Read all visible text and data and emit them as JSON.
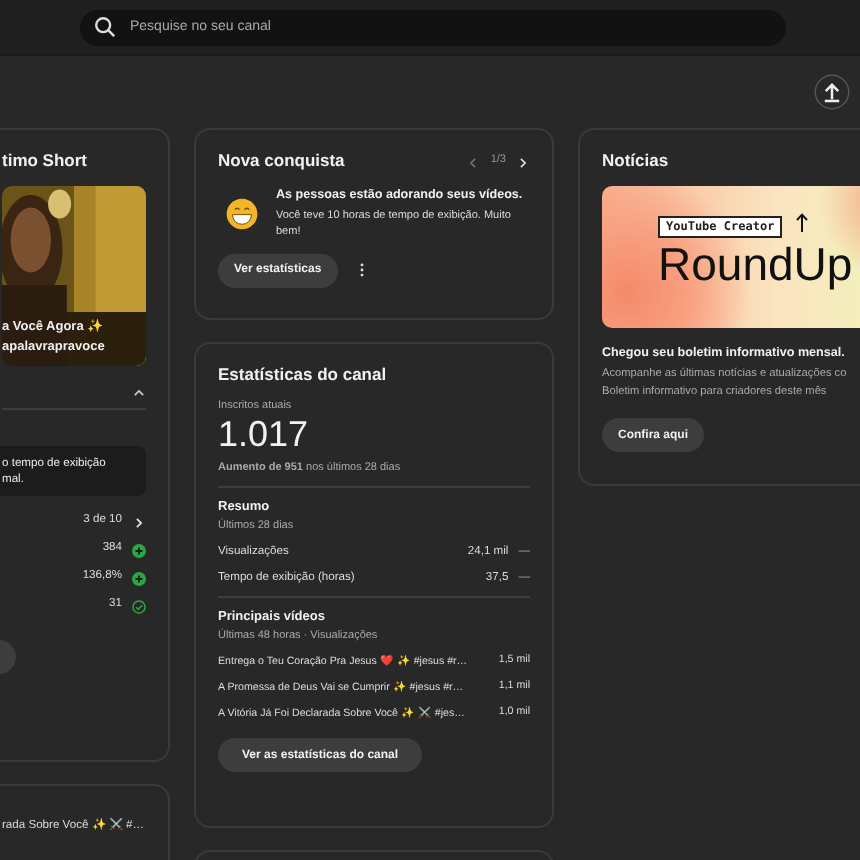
{
  "search": {
    "placeholder": "Pesquise no seu canal"
  },
  "short_card": {
    "title": "timo Short",
    "overlay_lines": [
      "a Você Agora ✨",
      "apalavrapravoce"
    ],
    "tip_lines": [
      "o tempo de exibição",
      "mal."
    ],
    "metrics": [
      {
        "kind": "pager",
        "value": "3 de 10"
      },
      {
        "kind": "up",
        "value": "384"
      },
      {
        "kind": "up",
        "value": "136,8%"
      },
      {
        "kind": "check",
        "value": "31"
      }
    ]
  },
  "short_card_2": {
    "line": "rada Sobre Você ✨ ⚔️ #…"
  },
  "achievement": {
    "title": "Nova conquista",
    "pager": {
      "text": "1/3",
      "prev_enabled": false,
      "next_enabled": true
    },
    "headline": "As pessoas estão adorando seus vídeos.",
    "body": "Você teve 10 horas de tempo de exibição. Muito bem!",
    "button": "Ver estatísticas"
  },
  "channel_stats": {
    "title": "Estatísticas do canal",
    "subscribers_label": "Inscritos atuais",
    "subscribers": "1.017",
    "growth": "**Aumento de 951** nos últimos 28 dias",
    "summary_title": "Resumo",
    "summary_period": "Últimos 28 dias",
    "summary": [
      {
        "label": "Visualizações",
        "value": "24,1 mil",
        "trend": "—"
      },
      {
        "label": "Tempo de exibição (horas)",
        "value": "37,5",
        "trend": "—"
      }
    ],
    "top_title": "Principais vídeos",
    "top_period": "Últimas 48 horas · Visualizações",
    "top_videos": [
      {
        "title": "Entrega o Teu Coração Pra Jesus ❤️ ✨ #jesus #r…",
        "views": "1,5 mil"
      },
      {
        "title": "A Promessa de Deus Vai se Cumprir ✨ #jesus #r…",
        "views": "1,1 mil"
      },
      {
        "title": "A Vitória Já Foi Declarada Sobre Você ✨ ⚔️ #jes…",
        "views": "1,0 mil"
      }
    ],
    "button": "Ver as estatísticas do canal"
  },
  "news": {
    "title": "Notícias",
    "banner_tag": "YouTube Creator",
    "banner_title": "RoundUp",
    "headline": "Chegou seu boletim informativo mensal.",
    "body_lines": [
      "Acompanhe as últimas notícias e atualizações co",
      "Boletim informativo para criadores deste mês"
    ],
    "button": "Confira aqui"
  }
}
